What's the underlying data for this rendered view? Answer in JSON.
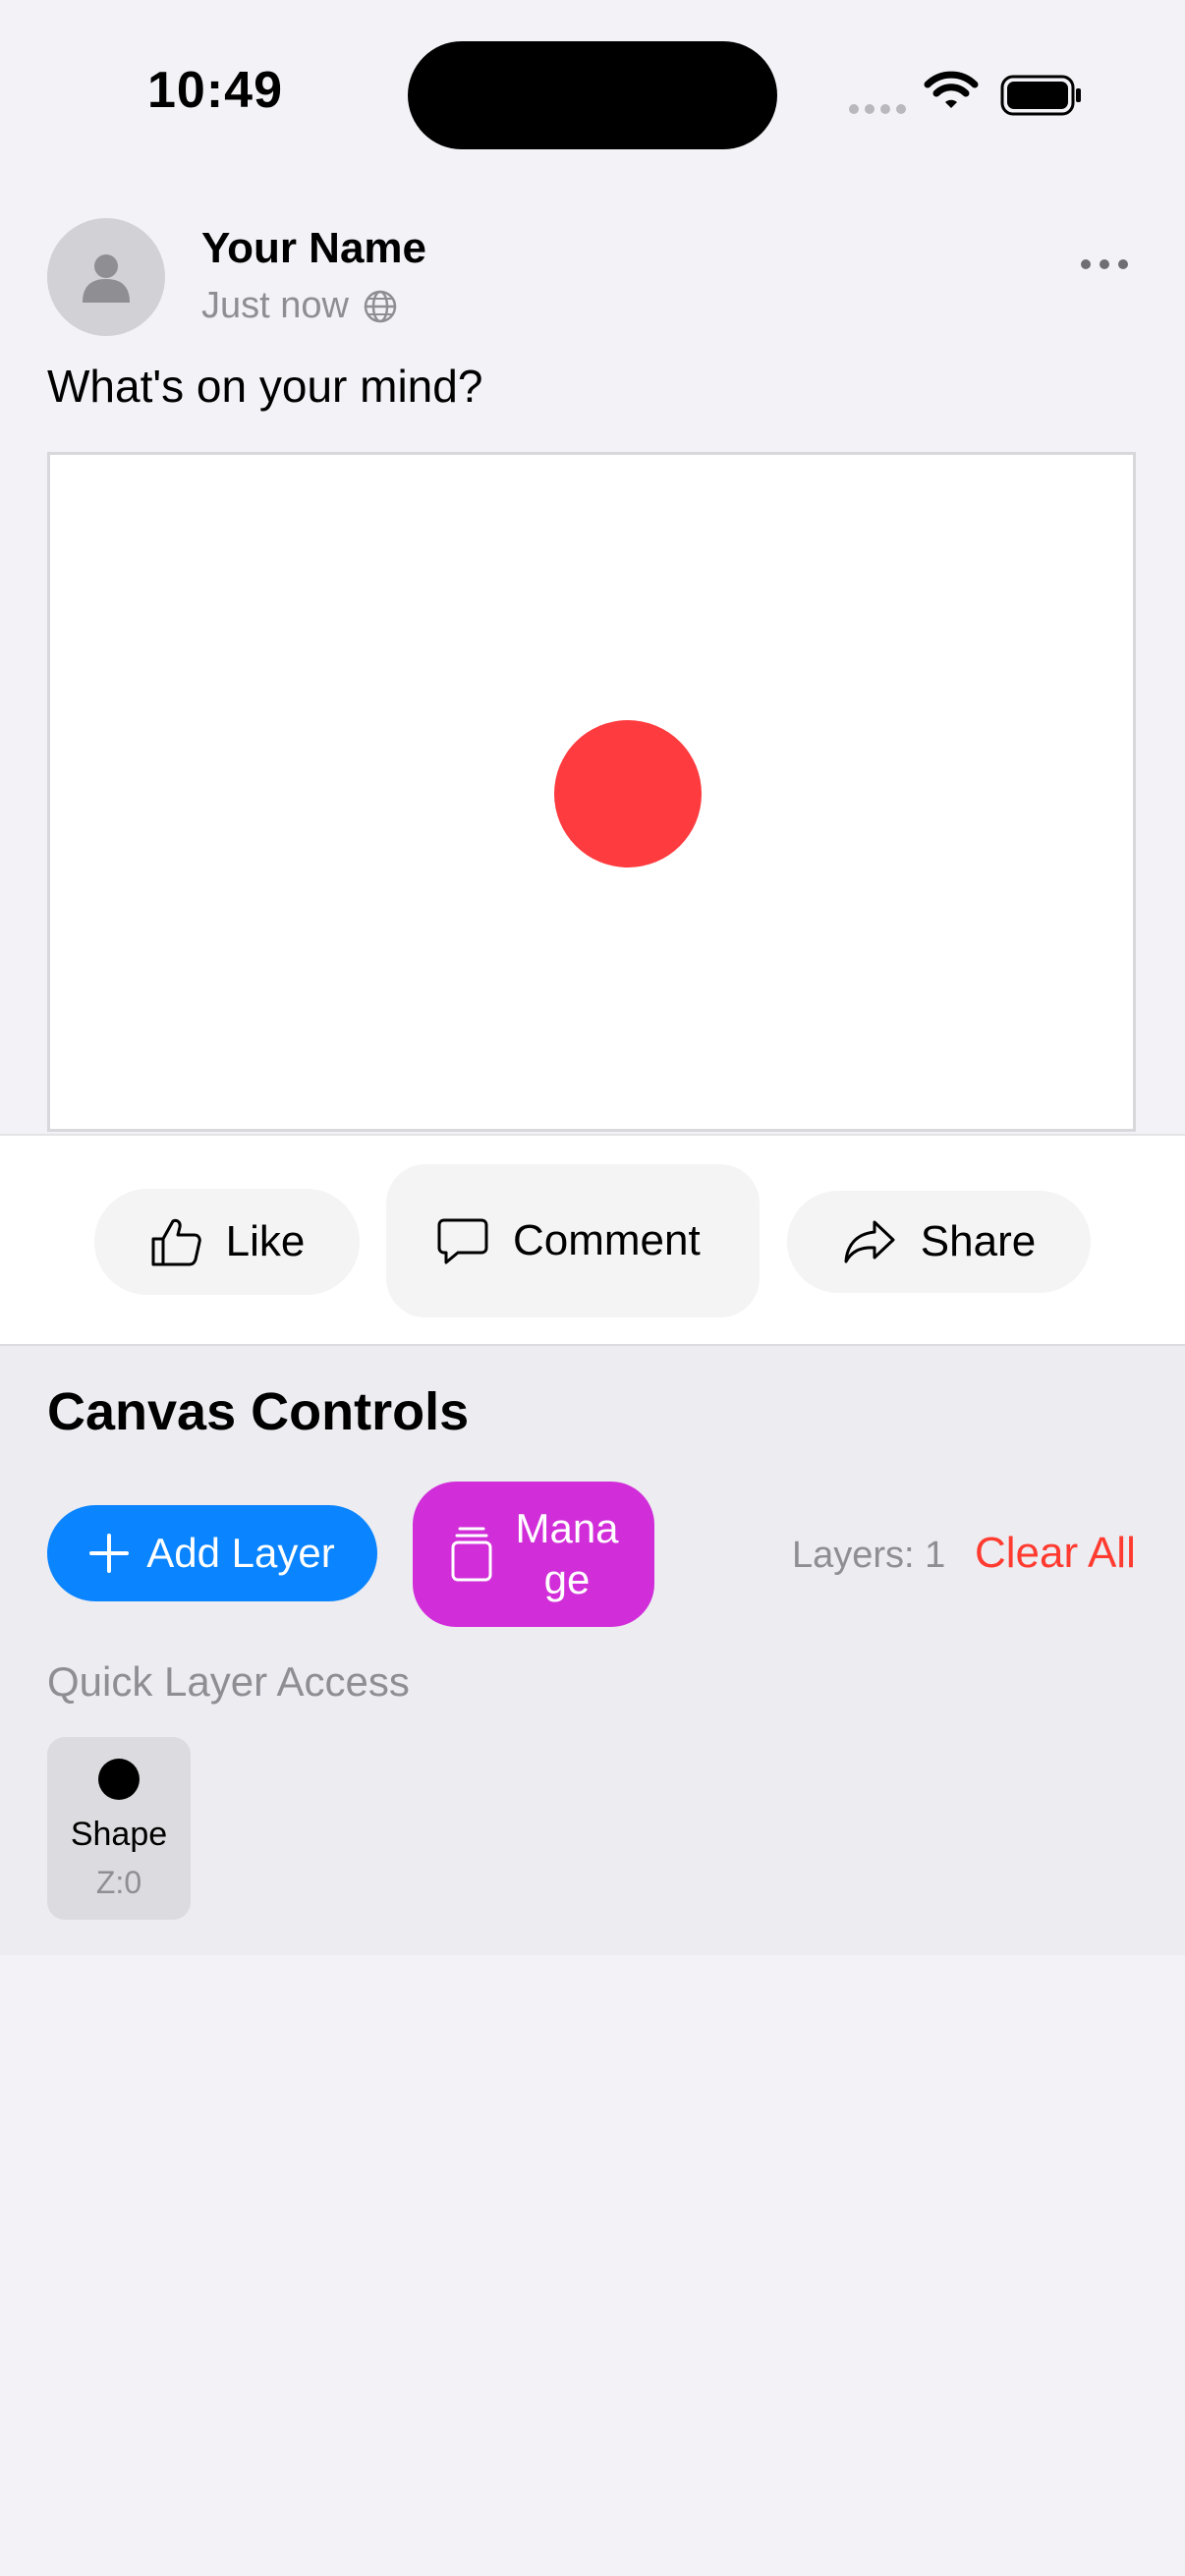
{
  "status_bar": {
    "time": "10:49"
  },
  "post": {
    "author": "Your Name",
    "timestamp": "Just now",
    "text": "What's on your mind?",
    "shape_color": "#fe3b3e"
  },
  "actions": {
    "like": "Like",
    "comment": "Comment",
    "share": "Share"
  },
  "controls": {
    "title": "Canvas Controls",
    "add_layer": "Add Layer",
    "manage": "Manage",
    "layers_count": "Layers: 1",
    "clear_all": "Clear All",
    "quick_access_title": "Quick Layer Access",
    "layers": [
      {
        "label": "Shape",
        "z": "Z:0"
      }
    ]
  },
  "colors": {
    "accent_blue": "#0a84ff",
    "manage_purple": "#d12ed9",
    "destructive_red": "#ff3b30"
  },
  "icons": [
    "person-icon",
    "globe-icon",
    "more-icon",
    "thumbs-up-icon",
    "comment-bubble-icon",
    "share-arrow-icon",
    "plus-icon",
    "layers-icon",
    "wifi-icon",
    "battery-icon"
  ]
}
